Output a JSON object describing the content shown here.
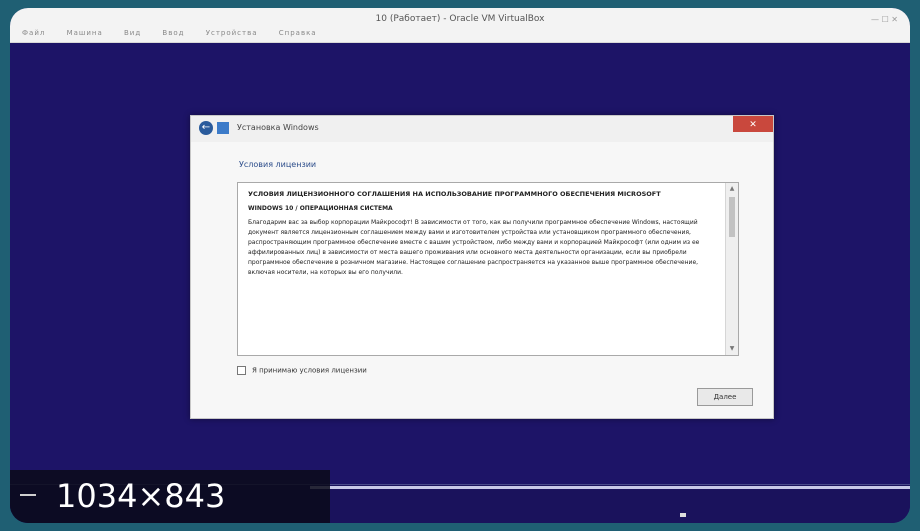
{
  "vm_window": {
    "title": "10 (Работает) - Oracle VM VirtualBox",
    "menu": [
      "Файл",
      "Машина",
      "Вид",
      "Ввод",
      "Устройства",
      "Справка"
    ],
    "window_buttons": "— ☐ ✕"
  },
  "setup_dialog": {
    "title": "Установка Windows",
    "close_label": "✕",
    "heading": "Условия лицензии",
    "license": {
      "heading": "УСЛОВИЯ ЛИЦЕНЗИОННОГО СОГЛАШЕНИЯ НА ИСПОЛЬЗОВАНИЕ ПРОГРАММНОГО ОБЕСПЕЧЕНИЯ MICROSOFT",
      "subheading": "WINDOWS 10 / ОПЕРАЦИОННАЯ СИСТЕМА",
      "paragraph": "Благодарим вас за выбор корпорации Майкрософт! В зависимости от того, как вы получили программное обеспечение Windows, настоящий документ является лицензионным соглашением между вами и изготовителем устройства или установщиком программного обеспечения, распространяющим программное обеспечение вместе с вашим устройством, либо между вами и корпорацией Майкрософт (или одним из ее аффилированных лиц) в зависимости от места вашего проживания или основного места деятельности организации, если вы приобрели программное обеспечение в розничном магазине. Настоящее соглашение распространяется на указанное выше программное обеспечение, включая носители, на которых вы его получили."
    },
    "accept_label": "Я принимаю условия лицензии",
    "next_label": "Далее"
  },
  "overlay": {
    "resolution": "1034×843"
  },
  "colors": {
    "desktop": "#1d1467",
    "outer_background": "#1f5f73",
    "close_button": "#c9483d"
  },
  "icons": {
    "back": "back-arrow-icon",
    "setup": "setup-icon"
  }
}
